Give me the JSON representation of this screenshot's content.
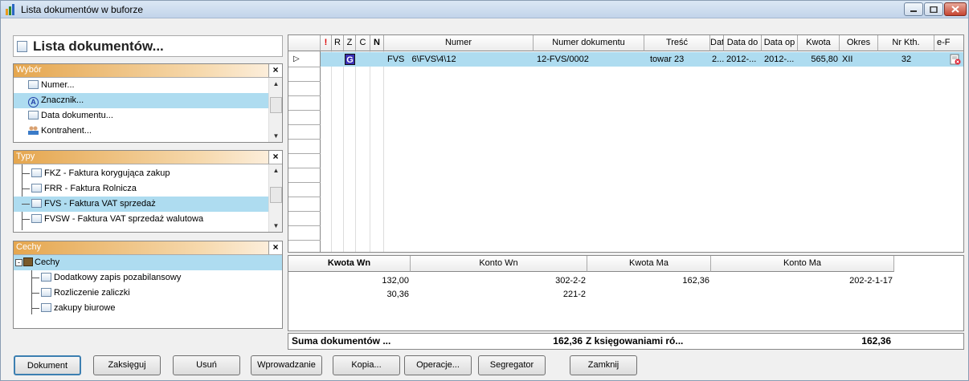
{
  "window": {
    "title": "Lista dokumentów w buforze"
  },
  "left_header": "Lista dokumentów...",
  "sections": {
    "wybor": {
      "title": "Wybór",
      "items": [
        "Numer...",
        "Znacznik...",
        "Data dokumentu...",
        "Kontrahent..."
      ],
      "selected": 1
    },
    "typy": {
      "title": "Typy",
      "items": [
        "FKZ - Faktura korygująca zakup",
        "FRR - Faktura Rolnicza",
        "FVS - Faktura VAT sprzedaż",
        "FVSW - Faktura VAT sprzedaż walutowa"
      ],
      "selected": 2
    },
    "cechy": {
      "title": "Cechy",
      "root": "Cechy",
      "items": [
        "Dodatkowy zapis pozabilansowy",
        "Rozliczenie zaliczki",
        "zakupy biurowe"
      ]
    }
  },
  "grid": {
    "columns": [
      "!",
      "R",
      "Z",
      "C",
      "N",
      "Numer",
      "Numer dokumentu",
      "Treść",
      "Dat",
      "Data do",
      "Data op",
      "Kwota",
      "Okres",
      "Nr Kth.",
      "e-F"
    ],
    "row": {
      "marker": "▷",
      "z_badge": "G",
      "numer": "FVS   6\\FVS\\4\\12",
      "numer_dok": "12-FVS/0002",
      "tresc": "towar 23",
      "dat": "2...",
      "data_do": "2012-...",
      "data_op": "2012-...",
      "kwota": "565,80",
      "okres": "XII",
      "nrkth": "32"
    }
  },
  "lower": {
    "columns": [
      "Kwota Wn",
      "Konto Wn",
      "Kwota Ma",
      "Konto Ma"
    ],
    "rows": [
      {
        "kwota_wn": "132,00",
        "konto_wn": "302-2-2",
        "kwota_ma": "162,36",
        "konto_ma": "202-2-1-17"
      },
      {
        "kwota_wn": "30,36",
        "konto_wn": "221-2",
        "kwota_ma": "",
        "konto_ma": ""
      }
    ]
  },
  "summary": {
    "label": "Suma dokumentów ...",
    "value1": "162,36",
    "label2": "Z księgowaniami ró...",
    "value2": "162,36"
  },
  "buttons": [
    "Dokument",
    "Zaksięguj",
    "Usuń",
    "Wprowadzanie",
    "Kopia...",
    "Operacje...",
    "Segregator",
    "Zamknij"
  ],
  "colors": {
    "selection": "#aedcf0",
    "section_header": "#e5a64e",
    "z_badge": "#3a2fb5"
  }
}
